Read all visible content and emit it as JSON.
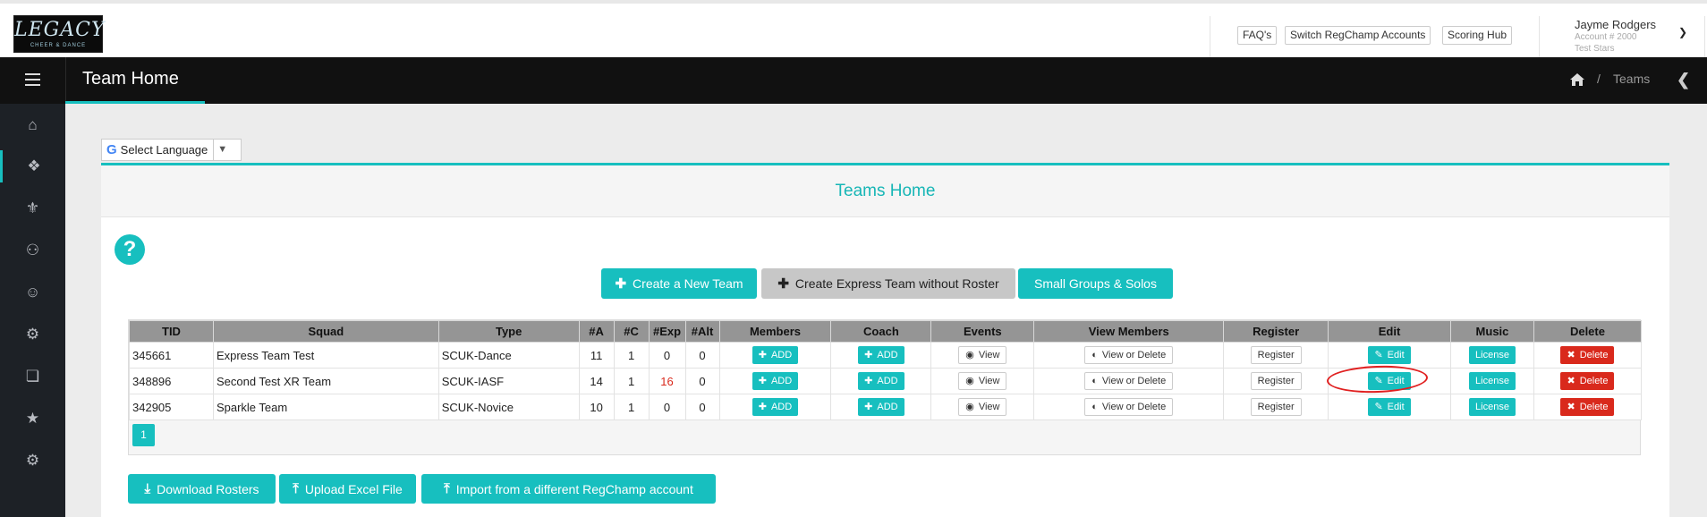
{
  "app": {
    "logo_main": "LEGACY",
    "logo_sub": "CHEER & DANCE"
  },
  "header": {
    "links": [
      "FAQ's",
      "Switch RegChamp Accounts",
      "Scoring Hub"
    ],
    "user_name": "Jayme Rodgers",
    "account": "Account # 2000",
    "team": "Test Stars"
  },
  "nav": {
    "page_heading": "Team Home",
    "breadcrumb_current": "Teams",
    "breadcrumb_sep": "/"
  },
  "sidebar": {
    "items": [
      "home-icon",
      "cubes-icon",
      "trophy-icon",
      "user-plus-icon",
      "users-icon",
      "gear-icon",
      "copy-icon",
      "star-icon",
      "gears-icon"
    ],
    "active_index": 1
  },
  "language": {
    "label": "Select Language"
  },
  "panel": {
    "title": "Teams Home",
    "help": "?"
  },
  "actions": {
    "create_team": "Create a New Team",
    "create_express": "Create Express Team without Roster",
    "small_groups": "Small Groups & Solos"
  },
  "table": {
    "columns": [
      "TID",
      "Squad",
      "Type",
      "#A",
      "#C",
      "#Exp",
      "#Alt",
      "Members",
      "Coach",
      "Events",
      "View Members",
      "Register",
      "Edit",
      "Music",
      "Delete"
    ],
    "rows": [
      {
        "tid": "345661",
        "squad": "Express Team Test",
        "type": "SCUK-Dance",
        "a": "11",
        "c": "1",
        "exp": "0",
        "alt": "0"
      },
      {
        "tid": "348896",
        "squad": "Second Test XR Team",
        "type": "SCUK-IASF",
        "a": "14",
        "c": "1",
        "exp": "16",
        "alt": "0"
      },
      {
        "tid": "342905",
        "squad": "Sparkle Team",
        "type": "SCUK-Novice",
        "a": "10",
        "c": "1",
        "exp": "0",
        "alt": "0"
      }
    ],
    "cell_buttons": {
      "add": "ADD",
      "view": "View",
      "view_delete": "View or Delete",
      "register": "Register",
      "edit": "Edit",
      "license": "License",
      "delete": "Delete"
    },
    "page": "1"
  },
  "footer_actions": {
    "download": "Download Rosters",
    "upload": "Upload Excel File",
    "import": "Import from a different RegChamp account"
  },
  "colors": {
    "accent": "#17bfbf",
    "danger": "#d9291c",
    "dark": "#111111"
  }
}
